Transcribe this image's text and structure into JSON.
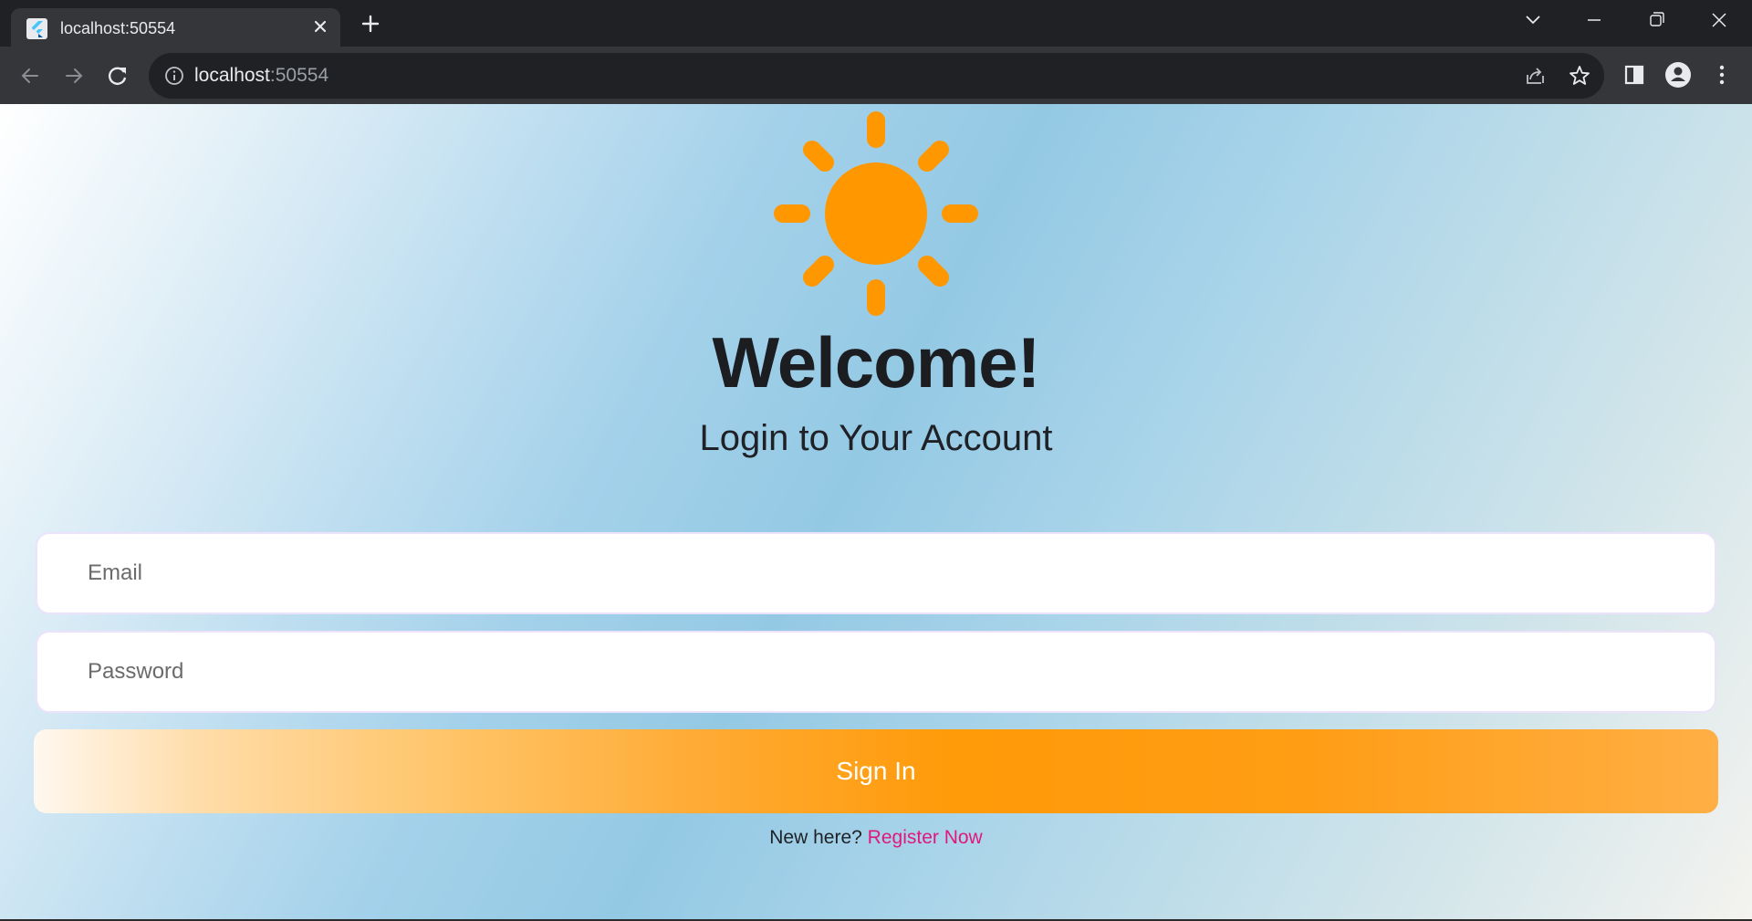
{
  "browser": {
    "tab_title": "localhost:50554",
    "url_host": "localhost",
    "url_port": ":50554",
    "icons": {
      "favicon": "flutter-logo-icon",
      "tab_close": "close-icon",
      "new_tab": "plus-icon",
      "tab_search": "chevron-down-icon",
      "minimize": "minimize-icon",
      "restore": "restore-icon",
      "close_window": "close-icon",
      "back": "arrow-left-icon",
      "forward": "arrow-right-icon",
      "reload": "reload-icon",
      "site_info": "info-icon",
      "share": "share-icon",
      "bookmark": "star-icon",
      "side_panel": "side-panel-icon",
      "profile": "profile-icon",
      "menu": "kebab-menu-icon"
    }
  },
  "page": {
    "logo_icon": "sun-icon",
    "title": "Welcome!",
    "subtitle": "Login to Your Account",
    "email_placeholder": "Email",
    "password_placeholder": "Password",
    "signin_label": "Sign In",
    "register_prompt": "New here?",
    "register_link": "Register Now"
  },
  "colors": {
    "sun": "#ff9800",
    "button_accent": "#ff9a08",
    "link": "#e0187a",
    "chrome_dark": "#202124",
    "chrome_toolbar": "#35363a"
  }
}
